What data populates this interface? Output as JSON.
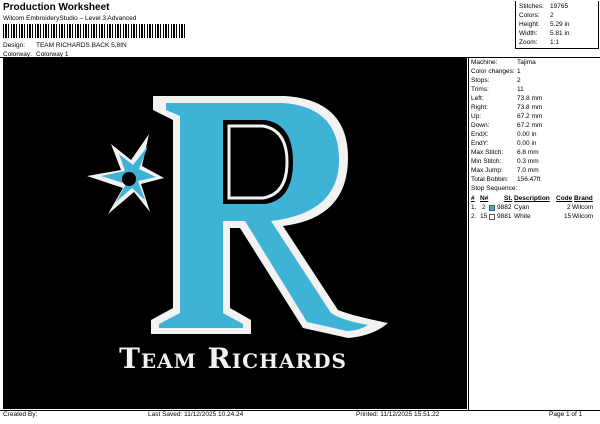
{
  "header": {
    "title": "Production Worksheet",
    "subtitle": "Wilcom EmbroideryStudio – Level 3 Advanced",
    "design_label": "Design:",
    "design_value": "TEAM RICHARDS BACK 5,8IN",
    "colorway_label": "Colorway:",
    "colorway_value": "Colorway 1"
  },
  "stats": [
    {
      "label": "Stitches:",
      "value": "19765"
    },
    {
      "label": "Colors:",
      "value": "2"
    },
    {
      "label": "Height:",
      "value": "5.29 in"
    },
    {
      "label": "Width:",
      "value": "5.81 in"
    },
    {
      "label": "Zoom:",
      "value": "1:1"
    }
  ],
  "design": {
    "team_text": "Team Richards",
    "letter": "R",
    "colors": {
      "background": "#000000",
      "cyan": "#3fb3d6",
      "white": "#f2f2f2"
    }
  },
  "machine_props": [
    {
      "label": "Machine:",
      "value": "Tajima"
    },
    {
      "label": "Color changes:",
      "value": "1"
    },
    {
      "label": "Stops:",
      "value": "2"
    },
    {
      "label": "Trims:",
      "value": "11"
    },
    {
      "label": "Left:",
      "value": "73.8 mm"
    },
    {
      "label": "Right:",
      "value": "73.8 mm"
    },
    {
      "label": "Up:",
      "value": "67.2 mm"
    },
    {
      "label": "Down:",
      "value": "67.2 mm"
    },
    {
      "label": "EndX:",
      "value": "0.00 in"
    },
    {
      "label": "EndY:",
      "value": "0.00 in"
    },
    {
      "label": "Max Stitch:",
      "value": "6.8 mm"
    },
    {
      "label": "Min Stitch:",
      "value": "0.3 mm"
    },
    {
      "label": "Max Jump:",
      "value": "7.0 mm"
    },
    {
      "label": "Total Bobbin:",
      "value": "156.47ft"
    }
  ],
  "stop_sequence": {
    "title": "Stop Sequence:",
    "columns": [
      "#",
      "N#",
      "St.",
      "Description",
      "Code",
      "Brand"
    ],
    "rows": [
      {
        "num": "1.",
        "needle": "2",
        "stitches": "9882",
        "description": "Cyan",
        "code": "2",
        "brand": "Wilcom",
        "color": "#3fb3d6"
      },
      {
        "num": "2.",
        "needle": "15",
        "stitches": "9881",
        "description": "White",
        "code": "15",
        "brand": "Wilcom",
        "color": "#ffffff"
      }
    ]
  },
  "footer": {
    "created": "Created By:",
    "saved": "Last Saved: 11/12/2025 10.24.24",
    "printed": "Printed: 11/12/2025 15.51.22",
    "page": "Page 1 of 1"
  }
}
